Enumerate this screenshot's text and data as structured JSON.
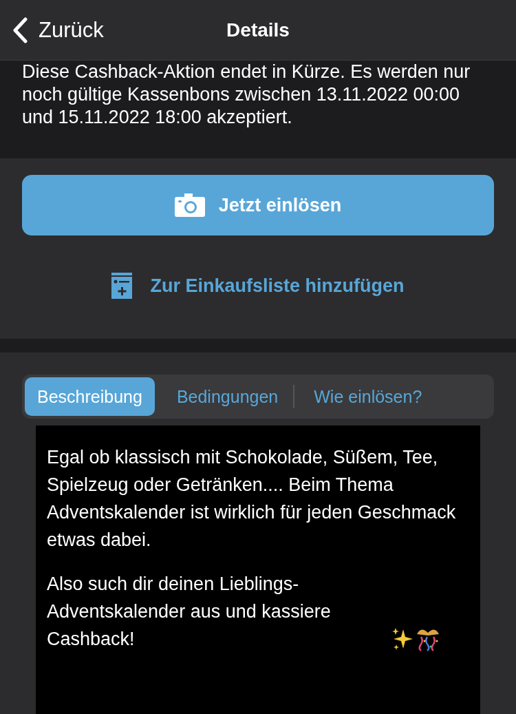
{
  "nav": {
    "back": "Zurück",
    "title": "Details"
  },
  "notice": "Diese Cashback-Aktion endet in Kürze. Es werden nur noch gültige Kassenbons zwischen 13.11.2022 00:00 und 15.11.2022 18:00 akzeptiert.",
  "primary_button": "Jetzt einlösen",
  "secondary_link": "Zur Einkaufsliste hinzufügen",
  "tabs": [
    {
      "label": "Beschreibung",
      "selected": true
    },
    {
      "label": "Bedingungen",
      "selected": false
    },
    {
      "label": "Wie einlösen?",
      "selected": false
    }
  ],
  "description": [
    "Egal ob klassisch mit Schokolade, Süßem, Tee, Spielzeug oder Getränken.... Beim Thema Adventskalender ist wirklich für jeden Geschmack etwas dabei.",
    "Also such dir deinen Lieblings-Adventskalender aus und kassiere Cashback!"
  ]
}
